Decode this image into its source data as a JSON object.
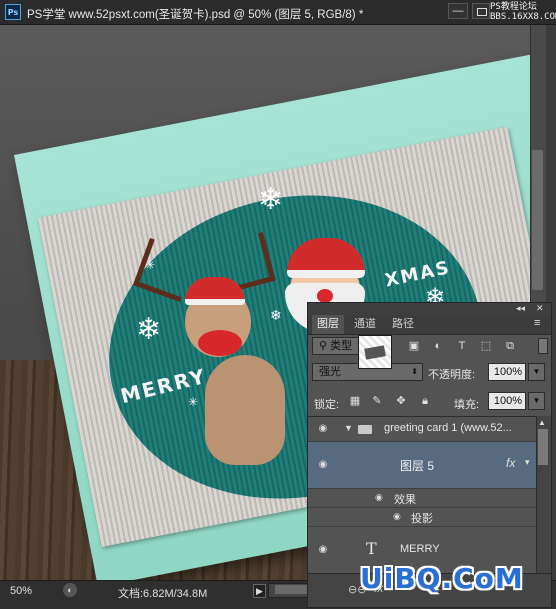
{
  "window": {
    "app_icon": "Ps",
    "title": "PS学堂 www.52psxt.com(圣诞贺卡).psd @ 50% (图层 5, RGB/8) *",
    "minimize": "—",
    "watermark_top": "PS教程论坛\nBBS.16XX8.COM"
  },
  "artwork": {
    "merry": "MERRY",
    "xmas": "XMAS"
  },
  "status": {
    "zoom": "50%",
    "doc_size": "文档:6.82M/34.8M"
  },
  "layers_panel": {
    "tabs": [
      "图层",
      "通道",
      "路径"
    ],
    "filter_kind": "类型",
    "blend_mode": "强光",
    "opacity_label": "不透明度:",
    "opacity_value": "100%",
    "lock_label": "锁定:",
    "fill_label": "填充:",
    "fill_value": "100%",
    "layers": {
      "group_name": "greeting card 1 (www.52...",
      "layer5_name": "图层 5",
      "fx": "fx",
      "effects_label": "效果",
      "drop_shadow_label": "投影",
      "merry_name": "MERRY",
      "text_glyph": "T"
    },
    "footer": {
      "link_icon": "link-icon",
      "fx_icon": "fx"
    }
  },
  "watermark_logo": "UiBQ.CoM",
  "colors": {
    "panel_bg": "#535353",
    "selected_row": "#586a80",
    "card_mint": "#a6e3d5",
    "oval_teal": "#1f7d7a",
    "watermark_blue": "#2a6fd6"
  }
}
